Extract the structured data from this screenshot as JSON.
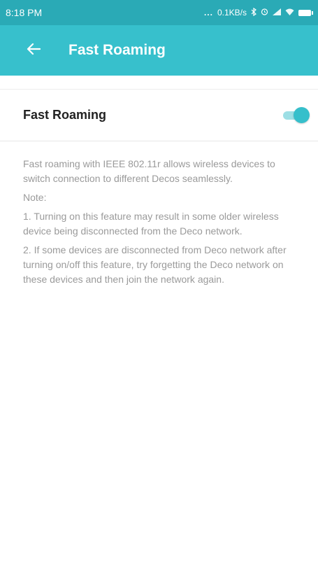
{
  "status_bar": {
    "time": "8:18 PM",
    "dots": "...",
    "speed": "0.1KB/s",
    "icons": [
      "bluetooth-icon",
      "alarm-icon",
      "signal-icon",
      "wifi-icon",
      "battery-icon"
    ]
  },
  "app_bar": {
    "back_icon": "arrow-left-icon",
    "title": "Fast Roaming"
  },
  "setting": {
    "label": "Fast Roaming",
    "enabled": true
  },
  "description": {
    "intro": "Fast roaming with IEEE 802.11r allows wireless devices to switch connection to different Decos seamlessly.",
    "note_label": "Note:",
    "note_1": "1. Turning on this feature may result in some older wireless device being disconnected from the Deco network.",
    "note_2": "2. If some devices are disconnected from Deco network after turning on/off this feature, try forgetting the Deco network on these devices and then join the network again."
  },
  "colors": {
    "status_bar": "#2aaab6",
    "app_bar": "#37c0cc",
    "toggle_thumb": "#36bfcb",
    "toggle_track": "#9ddfe5",
    "description_text": "#9a9a9a"
  }
}
